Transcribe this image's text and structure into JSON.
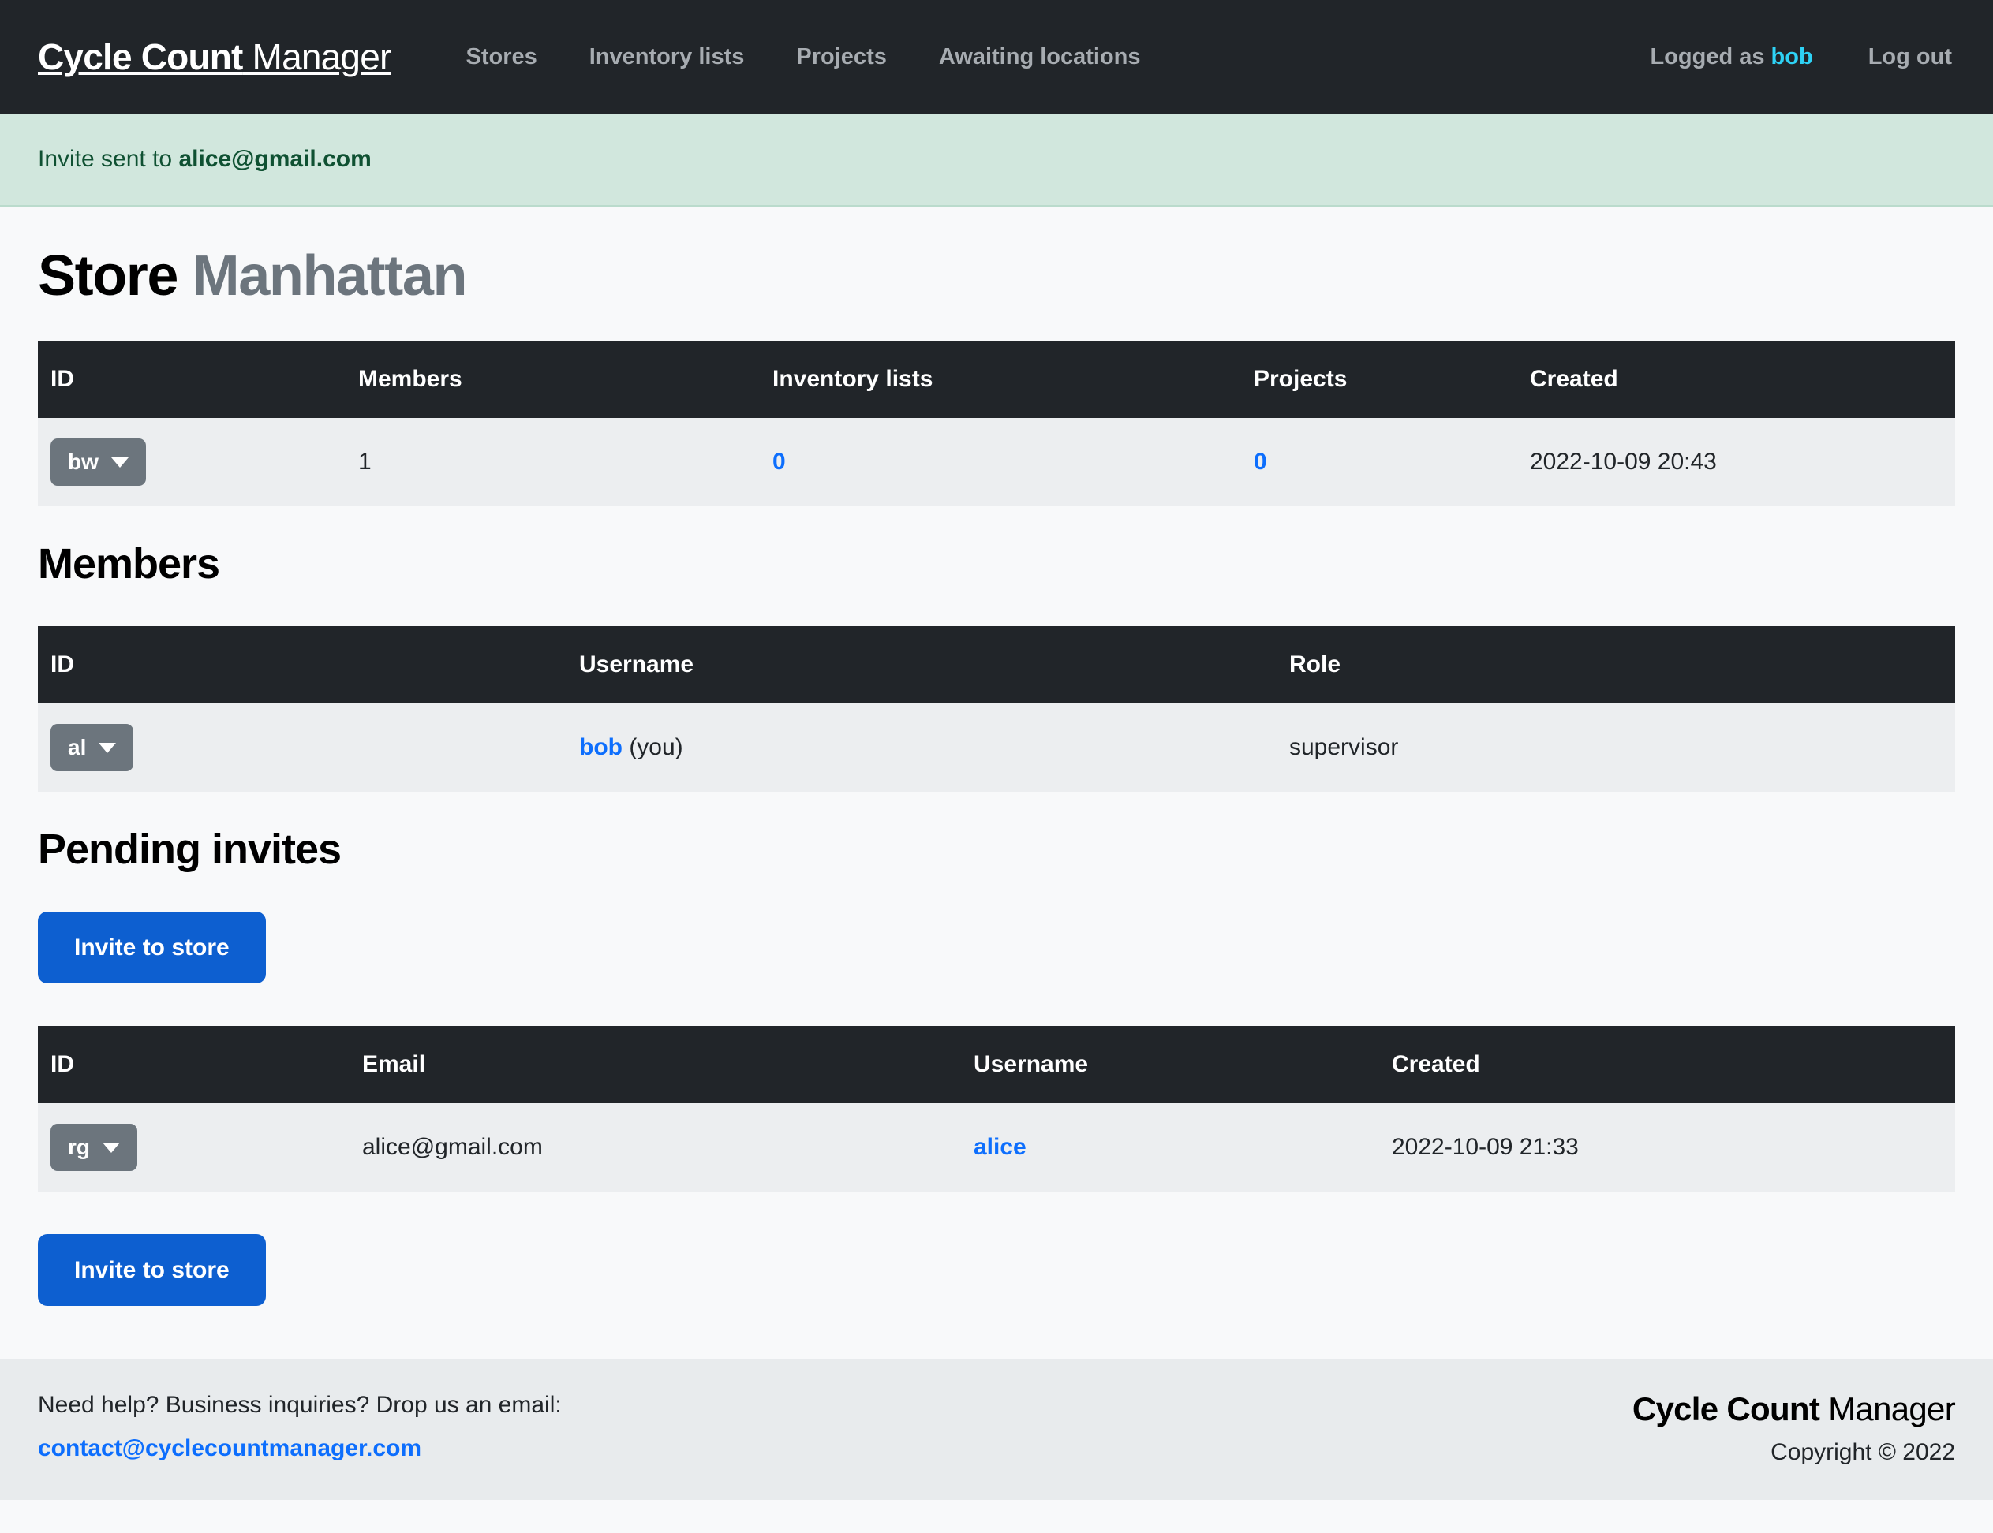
{
  "brand": {
    "bold": "Cycle Count",
    "light": " Manager"
  },
  "nav": {
    "links": [
      {
        "label": "Stores"
      },
      {
        "label": "Inventory lists"
      },
      {
        "label": "Projects"
      },
      {
        "label": "Awaiting locations"
      }
    ],
    "logged_as_prefix": "Logged as ",
    "username": "bob",
    "logout": "Log out"
  },
  "alert": {
    "prefix": "Invite sent to ",
    "email": "alice@gmail.com",
    "bg_color": "#d1e7dd",
    "text_color": "#0f5132"
  },
  "page": {
    "title_bold": "Store",
    "title_muted": "Manhattan"
  },
  "store_table": {
    "headers": [
      "ID",
      "Members",
      "Inventory lists",
      "Projects",
      "Created"
    ],
    "rows": [
      {
        "id": "bw",
        "members": "1",
        "inventory_lists": "0",
        "projects": "0",
        "created": "2022-10-09 20:43"
      }
    ]
  },
  "members_section": {
    "title": "Members",
    "headers": [
      "ID",
      "Username",
      "Role"
    ],
    "rows": [
      {
        "id": "al",
        "username": "bob",
        "username_suffix": " (you)",
        "role": "supervisor"
      }
    ]
  },
  "pending_section": {
    "title": "Pending invites",
    "invite_button_top": "Invite to store",
    "invite_button_bottom": "Invite to store",
    "headers": [
      "ID",
      "Email",
      "Username",
      "Created"
    ],
    "rows": [
      {
        "id": "rg",
        "email": "alice@gmail.com",
        "username": "alice",
        "created": "2022-10-09 21:33"
      }
    ]
  },
  "footer": {
    "help_text": "Need help? Business inquiries? Drop us an email:",
    "contact_email": "contact@cyclecountmanager.com",
    "brand_bold": "Cycle Count",
    "brand_light": " Manager",
    "copyright": "Copyright © 2022"
  },
  "colors": {
    "navbar": "#212529",
    "accent_blue": "#0d6efd",
    "button_blue": "#0d5fd0",
    "cyan": "#2ed2f5",
    "secondary_gray": "#6c757d",
    "page_bg": "#f8f9fa",
    "row_bg": "#eceef0",
    "footer_bg": "#e8ebed"
  }
}
